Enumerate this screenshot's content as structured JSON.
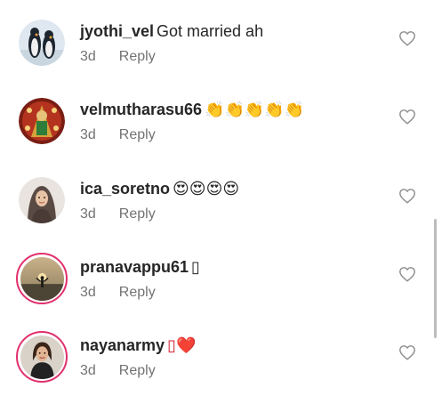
{
  "comments": [
    {
      "username": "jyothi_vel",
      "text": "Got married ah",
      "time": "3d",
      "reply_label": "Reply",
      "avatar": "penguins-avatar",
      "story_ring": false
    },
    {
      "username": "velmutharasu66",
      "text": "👏👏👏👏👏",
      "time": "3d",
      "reply_label": "Reply",
      "avatar": "deity-avatar",
      "story_ring": false
    },
    {
      "username": "ica_soretno",
      "text": "😍😍😍😍",
      "time": "3d",
      "reply_label": "Reply",
      "avatar": "woman-hijab-avatar",
      "story_ring": false
    },
    {
      "username": "pranavappu61",
      "text": "▯",
      "time": "3d",
      "reply_label": "Reply",
      "avatar": "sunset-avatar",
      "story_ring": true
    },
    {
      "username": "nayanarmy",
      "text": "▯❤️",
      "time": "3d",
      "reply_label": "Reply",
      "avatar": "actress-avatar",
      "story_ring": true
    }
  ],
  "colors": {
    "text": "#262626",
    "secondary": "#737373",
    "story_ring": "#e1306c",
    "heart_outline": "#8e8e8e"
  },
  "icons": {
    "like": "heart-outline-icon"
  }
}
